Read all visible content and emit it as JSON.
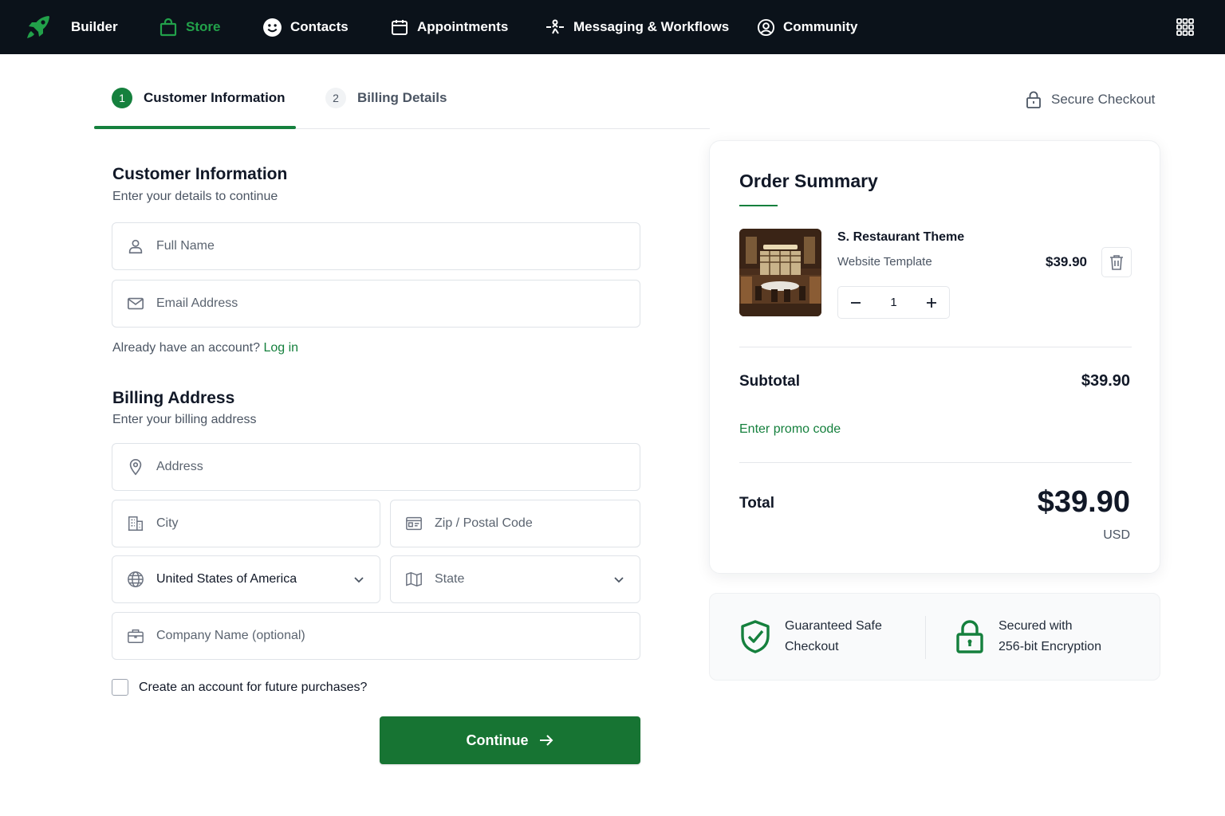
{
  "nav": {
    "items": [
      {
        "label": "Builder",
        "icon": "rocket-icon"
      },
      {
        "label": "Store",
        "icon": "shopping-bag-icon"
      },
      {
        "label": "Contacts",
        "icon": "smiley-icon"
      },
      {
        "label": "Appointments",
        "icon": "calendar-icon"
      },
      {
        "label": "Messaging & Workflows",
        "icon": "workflow-icon"
      },
      {
        "label": "Community",
        "icon": "user-circle-icon"
      }
    ],
    "active": "Store"
  },
  "steps": [
    {
      "number": "1",
      "label": "Customer Information"
    },
    {
      "number": "2",
      "label": "Billing Details"
    }
  ],
  "secure_checkout": "Secure Checkout",
  "customer": {
    "title": "Customer Information",
    "subtitle": "Enter your details to continue",
    "full_name_placeholder": "Full Name",
    "email_placeholder": "Email Address",
    "account_prompt": "Already have an account?",
    "login_link": "Log in"
  },
  "billing": {
    "title": "Billing Address",
    "subtitle": "Enter your billing address",
    "address_placeholder": "Address",
    "city_placeholder": "City",
    "zip_placeholder": "Zip / Postal Code",
    "country_value": "United States of America",
    "state_placeholder": "State",
    "company_placeholder": "Company Name (optional)"
  },
  "create_account_label": "Create an account for future purchases?",
  "continue_label": "Continue",
  "order": {
    "title": "Order Summary",
    "product_name": "S. Restaurant Theme",
    "product_type": "Website Template",
    "product_price": "$39.90",
    "quantity": "1",
    "subtotal_label": "Subtotal",
    "subtotal_value": "$39.90",
    "promo_label": "Enter promo code",
    "total_label": "Total",
    "total_value": "$39.90",
    "currency": "USD"
  },
  "trust": {
    "safe_line1": "Guaranteed Safe",
    "safe_line2": "Checkout",
    "enc_line1": "Secured with",
    "enc_line2": "256-bit Encryption"
  },
  "colors": {
    "brand_green": "#15803d",
    "nav_bg": "#0b121a",
    "nav_active": "#22a14a"
  }
}
